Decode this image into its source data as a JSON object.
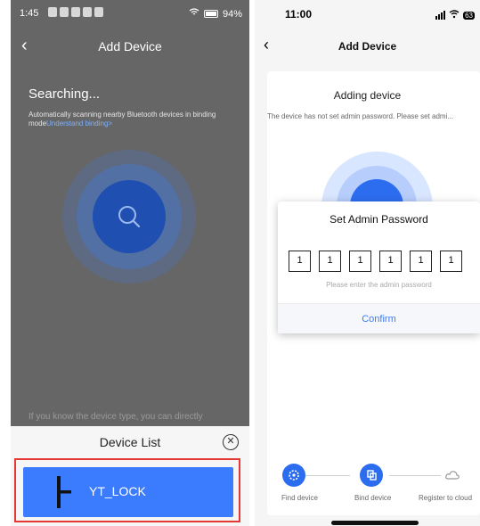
{
  "left_screen": {
    "status_bar": {
      "time": "1:45",
      "battery": "94%"
    },
    "header": {
      "back_icon": "chevron-left-icon",
      "title": "Add Device"
    },
    "search": {
      "heading": "Searching...",
      "hint_text": "Automatically scanning nearby Bluetooth devices in binding mode",
      "hint_link": "Understand binding>",
      "radar_icon": "search-icon"
    },
    "bottom_hint": "If you know the device type, you can directly",
    "device_list": {
      "title": "Device List",
      "close_icon": "close-circle-icon",
      "items": [
        {
          "name": "YT_LOCK",
          "icon": "door-lock-icon",
          "highlight_color": "#e53935"
        }
      ]
    },
    "colors": {
      "accent": "#3b7cff",
      "overlay": "rgba(0,0,0,0.58)"
    }
  },
  "right_screen": {
    "status_bar": {
      "time": "11:00",
      "battery": "63"
    },
    "header": {
      "back_icon": "chevron-left-icon",
      "title": "Add Device"
    },
    "progress": {
      "title": "Adding device",
      "warning": "The device has not set admin password. Please set admi..."
    },
    "modal": {
      "title": "Set Admin Password",
      "digits": [
        "1",
        "1",
        "1",
        "1",
        "1",
        "1"
      ],
      "hint": "Please enter the admin password",
      "confirm": "Confirm"
    },
    "steps": [
      {
        "label": "Find device",
        "icon": "bluetooth-scan-icon",
        "state": "done"
      },
      {
        "label": "Bind device",
        "icon": "bind-icon",
        "state": "active"
      },
      {
        "label": "Register to cloud",
        "icon": "cloud-icon",
        "state": "pending"
      }
    ],
    "colors": {
      "accent": "#3a7bf5",
      "step_active": "#2c6df0"
    }
  }
}
